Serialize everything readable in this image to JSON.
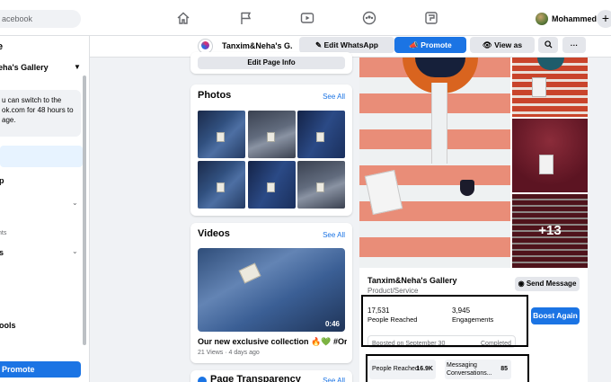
{
  "topbar": {
    "search_placeholder": "acebook",
    "profile_name": "Mohammed",
    "plus_label": "+"
  },
  "left": {
    "title": "e",
    "page_name": "eha's Gallery",
    "notice": "u can switch to the\nok.com for 48 hours to\nage.",
    "item_p": "p",
    "small_nts": "nts",
    "item_s": "s",
    "item_ools": "ools",
    "promote_label": "Promote"
  },
  "pagebar": {
    "page_name": "Tanxim&Neha's G...",
    "edit_whatsapp": "Edit WhatsApp",
    "promote": "Promote",
    "view_as_visitor": "View as Visitor",
    "more": "···"
  },
  "middle": {
    "edit_page_info": "Edit Page Info",
    "photos_title": "Photos",
    "see_all": "See All",
    "videos_title": "Videos",
    "video_duration": "0:46",
    "video_title": "Our new exclusive collection 🔥💚 #Ord...",
    "video_meta": "21 Views · 4 days ago",
    "transparency_title": "Page Transparency"
  },
  "post": {
    "more_photos": "+13",
    "page_name": "Tanxim&Neha's Gallery",
    "category": "Product/Service",
    "send_message": "Send Message",
    "people_reached_value": "17,531",
    "people_reached_label": "People Reached",
    "engagements_value": "3,945",
    "engagements_label": "Engagements",
    "boost_again": "Boost Again",
    "boosted_on": "Boosted on September 30",
    "status": "Completed",
    "mini_people_label": "People Reached",
    "mini_people_value": "16.9K",
    "mini_msg_label": "Messaging Conversations...",
    "mini_msg_value": "85"
  },
  "colors": {
    "brand_blue": "#1b74e4",
    "background": "#f0f2f5",
    "annotation": "#000000"
  }
}
